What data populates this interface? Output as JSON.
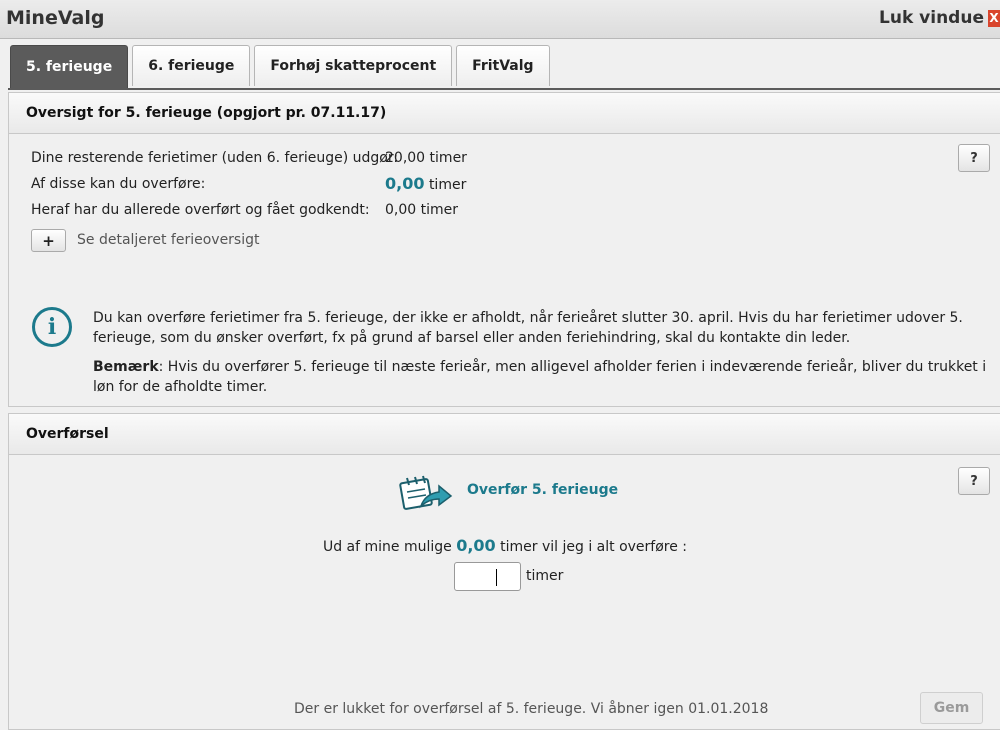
{
  "window": {
    "title": "MineValg",
    "close_label": "Luk vindue",
    "close_glyph": "X"
  },
  "tabs": [
    {
      "label": "5. ferieuge",
      "active": true
    },
    {
      "label": "6. ferieuge",
      "active": false
    },
    {
      "label": "Forhøj skatteprocent",
      "active": false
    },
    {
      "label": "FritValg",
      "active": false
    }
  ],
  "overview": {
    "heading": "Oversigt for 5. ferieuge (opgjort pr. 07.11.17)",
    "help_label": "?",
    "rows": [
      {
        "label": "Dine resterende ferietimer (uden 6. ferieuge) udgør:",
        "value": "20,00",
        "unit": "timer"
      },
      {
        "label": "Af disse kan du overføre:",
        "value": "0,00",
        "unit": "timer"
      },
      {
        "label": "Heraf har du allerede overført og fået godkendt:",
        "value": "0,00",
        "unit": "timer"
      }
    ],
    "expand_label": "+",
    "details_link": "Se detaljeret ferieoversigt",
    "info_icon": "i",
    "info_text": "Du kan overføre ferietimer fra 5. ferieuge, der ikke er afholdt, når ferieåret slutter 30. april. Hvis du har ferietimer udover 5. ferieuge, som du ønsker overført, fx på grund af barsel eller anden feriehindring, skal du kontakte din leder.",
    "note_bold": "Bemærk",
    "note_text": ": Hvis du overfører 5. ferieuge til næste ferieår, men alligevel afholder ferien i indeværende ferieår, bliver du trukket i løn for de afholdte timer."
  },
  "transfer": {
    "heading": "Overførsel",
    "help_label": "?",
    "title": "Overfør 5. ferieuge",
    "question_prefix": "Ud af mine mulige",
    "question_value": "0,00",
    "question_suffix": "timer vil jeg i alt overføre :",
    "input_value": "",
    "unit": "timer",
    "footer_message": "Der er lukket for overførsel af 5. ferieuge. Vi åbner igen 01.01.2018",
    "save_label": "Gem"
  },
  "colors": {
    "accent": "#1c7a8c",
    "active_tab": "#5b5b5b",
    "close": "#d9452d"
  }
}
